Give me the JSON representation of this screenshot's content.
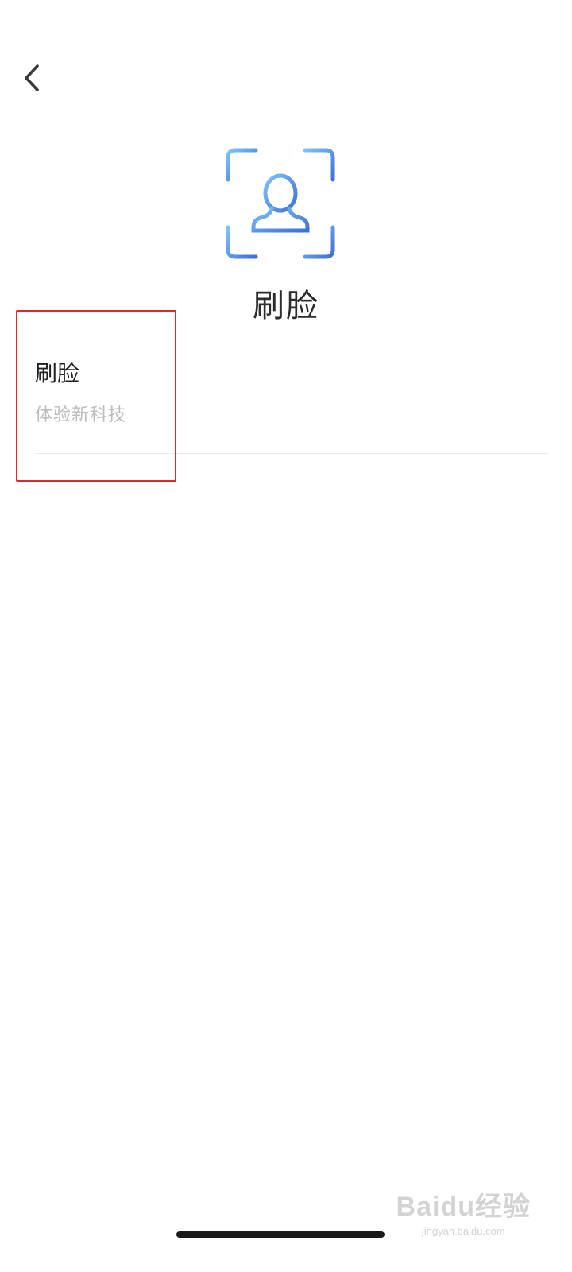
{
  "header": {
    "back_icon": "chevron-left-icon"
  },
  "hero": {
    "icon": "face-scan-icon",
    "icon_colors": [
      "#7cc4f5",
      "#3f6fd9"
    ],
    "title": "刷脸"
  },
  "list": {
    "items": [
      {
        "title": "刷脸",
        "subtitle": "体验新科技"
      }
    ]
  },
  "annotation": {
    "highlight_color": "#e2282f"
  },
  "watermark": {
    "main": "Baidu经验",
    "sub": "jingyan.baidu.com"
  }
}
